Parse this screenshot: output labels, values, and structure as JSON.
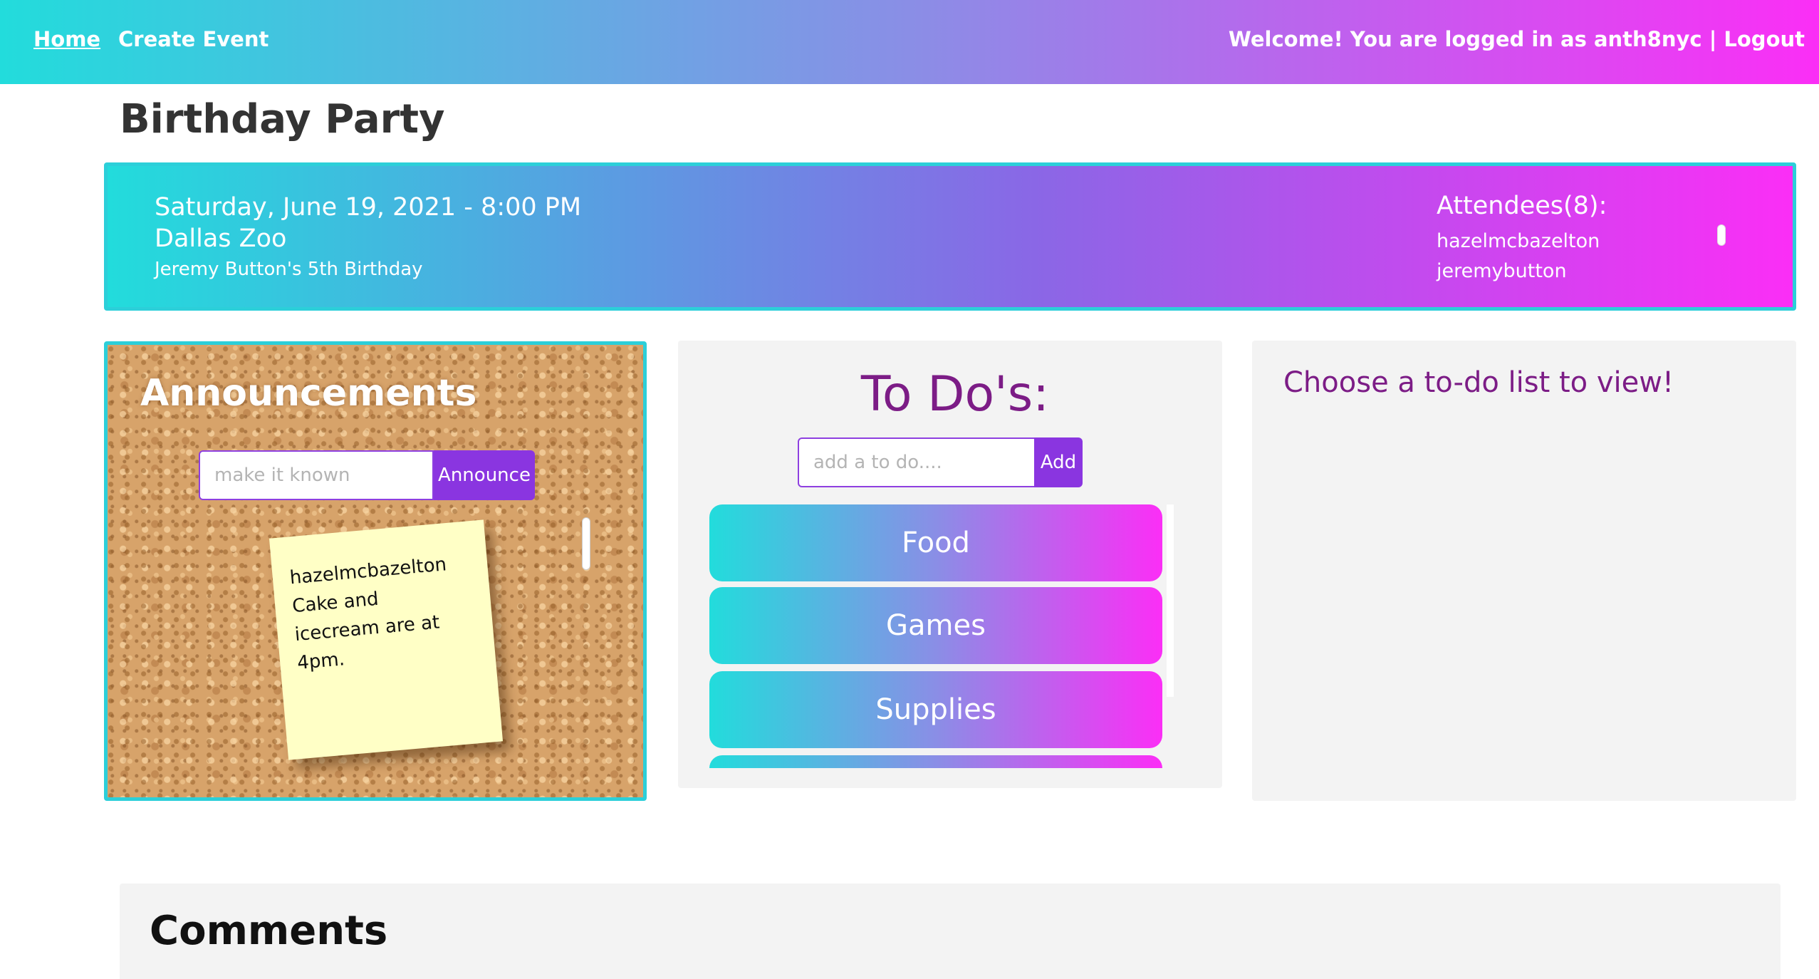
{
  "nav": {
    "home": "Home",
    "create_event": "Create Event",
    "welcome": "Welcome! You are logged in as anth8nyc",
    "separator": " | ",
    "logout": "Logout"
  },
  "event": {
    "title": "Birthday Party",
    "datetime": "Saturday, June 19, 2021 - 8:00 PM",
    "venue": "Dallas Zoo",
    "description": "Jeremy Button's 5th Birthday"
  },
  "attendees": {
    "label": "Attendees(8):",
    "names": [
      "hazelmcbazelton",
      "jeremybutton"
    ]
  },
  "announcements": {
    "title": "Announcements",
    "input_placeholder": "make it known",
    "button": "Announce",
    "notes": [
      {
        "author": "hazelmcbazelton",
        "text": "Cake and icecream are at 4pm."
      }
    ]
  },
  "todos": {
    "title": "To Do's:",
    "input_placeholder": "add a to do....",
    "add_button": "Add",
    "lists": [
      "Food",
      "Games",
      "Supplies",
      ""
    ]
  },
  "todo_view": {
    "prompt": "Choose a to-do list to view!"
  },
  "comments": {
    "title": "Comments"
  },
  "colors": {
    "gradient_start": "#22dcdc",
    "gradient_end": "#fb2ef6",
    "button_purple": "#8a35e0",
    "heading_purple": "#7c1c86"
  }
}
